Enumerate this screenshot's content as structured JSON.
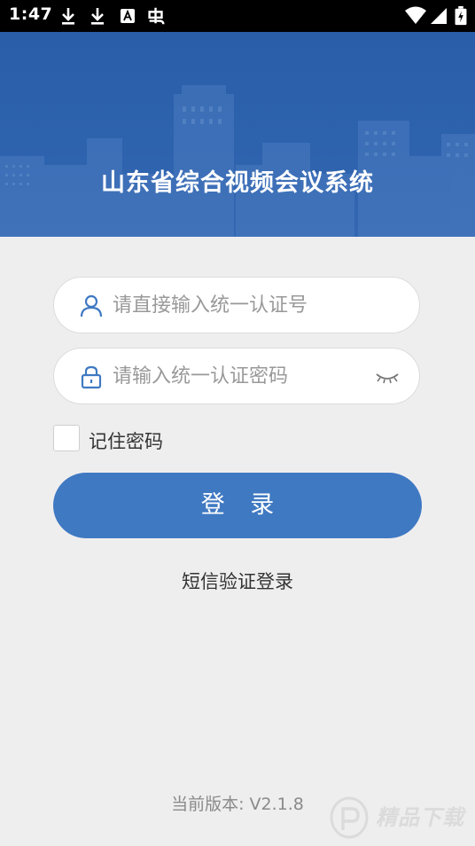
{
  "status_bar": {
    "time": "1:47",
    "icons": [
      "download-icon",
      "download-icon",
      "text-a-icon",
      "bug-icon",
      "wifi-icon",
      "signal-icon",
      "battery-icon"
    ]
  },
  "banner": {
    "title": "山东省综合视频会议系统",
    "background_color": "#2d62ad"
  },
  "form": {
    "username": {
      "placeholder": "请直接输入统一认证号",
      "value": "",
      "icon": "user-icon"
    },
    "password": {
      "placeholder": "请输入统一认证密码",
      "value": "",
      "icon": "lock-icon",
      "toggle_icon": "eye-closed-icon"
    },
    "remember_label": "记住密码",
    "remember_checked": false,
    "login_label": "登 录",
    "sms_login_label": "短信验证登录"
  },
  "footer": {
    "version_prefix": "当前版本: ",
    "version": "V2.1.8"
  },
  "watermark": {
    "text": "精品下载"
  },
  "colors": {
    "accent": "#3f79c2",
    "page_background": "#efeeef"
  }
}
